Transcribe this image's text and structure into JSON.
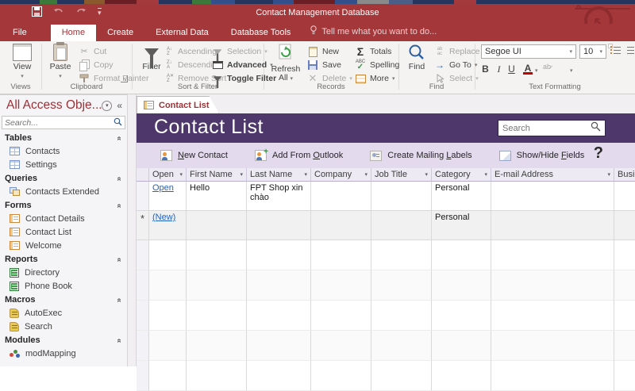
{
  "theme": {
    "accent_red": "#a4373a",
    "accent_purple": "#4e386b",
    "toolbar_lavender": "#e4daee",
    "link_blue": "#1f62c5"
  },
  "titlebar": {
    "title": "Contact Management Database"
  },
  "ribbon": {
    "tabs": [
      {
        "label": "File"
      },
      {
        "label": "Home"
      },
      {
        "label": "Create"
      },
      {
        "label": "External Data"
      },
      {
        "label": "Database Tools"
      }
    ],
    "tellme": "Tell me what you want to do...",
    "views": {
      "group": "Views",
      "view": "View"
    },
    "clipboard": {
      "group": "Clipboard",
      "paste": "Paste",
      "cut": "Cut",
      "copy": "Copy",
      "format_painter": "Format Painter"
    },
    "sort": {
      "group": "Sort & Filter",
      "filter": "Filter",
      "ascending": "Ascending",
      "descending": "Descending",
      "remove_sort": "Remove Sort",
      "selection": "Selection",
      "advanced": "Advanced",
      "toggle_filter": "Toggle Filter"
    },
    "records": {
      "group": "Records",
      "refresh_line1": "Refresh",
      "refresh_line2": "All",
      "new": "New",
      "save": "Save",
      "delete": "Delete",
      "totals": "Totals",
      "spelling": "Spelling",
      "more": "More"
    },
    "find": {
      "group": "Find",
      "find": "Find",
      "replace": "Replace",
      "goto": "Go To",
      "select": "Select"
    },
    "text": {
      "group": "Text Formatting",
      "font_name": "Segoe UI",
      "font_size": "10",
      "bold": "B",
      "italic": "I",
      "underline": "U",
      "color_a": "A"
    }
  },
  "nav": {
    "title": "All Access Obje...",
    "search_placeholder": "Search...",
    "sections": [
      {
        "label": "Tables",
        "items": [
          {
            "label": "Contacts"
          },
          {
            "label": "Settings"
          }
        ]
      },
      {
        "label": "Queries",
        "items": [
          {
            "label": "Contacts Extended"
          }
        ]
      },
      {
        "label": "Forms",
        "items": [
          {
            "label": "Contact Details"
          },
          {
            "label": "Contact List"
          },
          {
            "label": "Welcome"
          }
        ]
      },
      {
        "label": "Reports",
        "items": [
          {
            "label": "Directory"
          },
          {
            "label": "Phone Book"
          }
        ]
      },
      {
        "label": "Macros",
        "items": [
          {
            "label": "AutoExec"
          },
          {
            "label": "Search"
          }
        ]
      },
      {
        "label": "Modules",
        "items": [
          {
            "label": "modMapping"
          }
        ]
      }
    ]
  },
  "doc": {
    "tab": "Contact List",
    "banner_title": "Contact List",
    "search_placeholder": "Search",
    "help": "?",
    "actions": {
      "new_contact": {
        "pre": "",
        "key": "N",
        "rest": "ew Contact"
      },
      "add_outlook": {
        "pre": "Add From ",
        "key": "O",
        "rest": "utlook"
      },
      "mailing_labels": {
        "pre": "Create Mailing ",
        "key": "L",
        "rest": "abels"
      },
      "show_hide": {
        "pre": "Show/Hide ",
        "key": "F",
        "rest": "ields"
      }
    }
  },
  "table": {
    "headers": [
      {
        "label": "Open"
      },
      {
        "label": "First Name"
      },
      {
        "label": "Last Name"
      },
      {
        "label": "Company"
      },
      {
        "label": "Job Title"
      },
      {
        "label": "Category"
      },
      {
        "label": "E-mail Address"
      },
      {
        "label": "Busi"
      }
    ],
    "rows": [
      {
        "selector": "",
        "open": "Open",
        "first_name": "Hello",
        "last_name": "FPT Shop xin chào",
        "company": "",
        "job_title": "",
        "category": "Personal",
        "email": "",
        "business": ""
      },
      {
        "selector": "*",
        "open": "(New)",
        "first_name": "",
        "last_name": "",
        "company": "",
        "job_title": "",
        "category": "Personal",
        "email": "",
        "business": ""
      }
    ]
  }
}
